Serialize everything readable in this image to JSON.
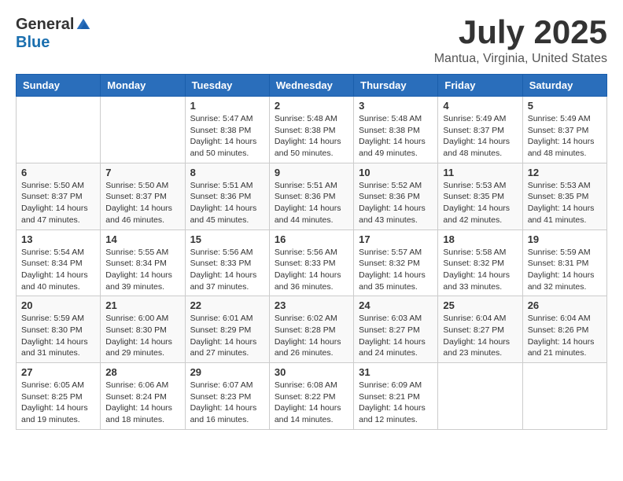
{
  "logo": {
    "general": "General",
    "blue": "Blue"
  },
  "title": "July 2025",
  "location": "Mantua, Virginia, United States",
  "weekdays": [
    "Sunday",
    "Monday",
    "Tuesday",
    "Wednesday",
    "Thursday",
    "Friday",
    "Saturday"
  ],
  "weeks": [
    [
      {
        "day": "",
        "sunrise": "",
        "sunset": "",
        "daylight": ""
      },
      {
        "day": "",
        "sunrise": "",
        "sunset": "",
        "daylight": ""
      },
      {
        "day": "1",
        "sunrise": "Sunrise: 5:47 AM",
        "sunset": "Sunset: 8:38 PM",
        "daylight": "Daylight: 14 hours and 50 minutes."
      },
      {
        "day": "2",
        "sunrise": "Sunrise: 5:48 AM",
        "sunset": "Sunset: 8:38 PM",
        "daylight": "Daylight: 14 hours and 50 minutes."
      },
      {
        "day": "3",
        "sunrise": "Sunrise: 5:48 AM",
        "sunset": "Sunset: 8:38 PM",
        "daylight": "Daylight: 14 hours and 49 minutes."
      },
      {
        "day": "4",
        "sunrise": "Sunrise: 5:49 AM",
        "sunset": "Sunset: 8:37 PM",
        "daylight": "Daylight: 14 hours and 48 minutes."
      },
      {
        "day": "5",
        "sunrise": "Sunrise: 5:49 AM",
        "sunset": "Sunset: 8:37 PM",
        "daylight": "Daylight: 14 hours and 48 minutes."
      }
    ],
    [
      {
        "day": "6",
        "sunrise": "Sunrise: 5:50 AM",
        "sunset": "Sunset: 8:37 PM",
        "daylight": "Daylight: 14 hours and 47 minutes."
      },
      {
        "day": "7",
        "sunrise": "Sunrise: 5:50 AM",
        "sunset": "Sunset: 8:37 PM",
        "daylight": "Daylight: 14 hours and 46 minutes."
      },
      {
        "day": "8",
        "sunrise": "Sunrise: 5:51 AM",
        "sunset": "Sunset: 8:36 PM",
        "daylight": "Daylight: 14 hours and 45 minutes."
      },
      {
        "day": "9",
        "sunrise": "Sunrise: 5:51 AM",
        "sunset": "Sunset: 8:36 PM",
        "daylight": "Daylight: 14 hours and 44 minutes."
      },
      {
        "day": "10",
        "sunrise": "Sunrise: 5:52 AM",
        "sunset": "Sunset: 8:36 PM",
        "daylight": "Daylight: 14 hours and 43 minutes."
      },
      {
        "day": "11",
        "sunrise": "Sunrise: 5:53 AM",
        "sunset": "Sunset: 8:35 PM",
        "daylight": "Daylight: 14 hours and 42 minutes."
      },
      {
        "day": "12",
        "sunrise": "Sunrise: 5:53 AM",
        "sunset": "Sunset: 8:35 PM",
        "daylight": "Daylight: 14 hours and 41 minutes."
      }
    ],
    [
      {
        "day": "13",
        "sunrise": "Sunrise: 5:54 AM",
        "sunset": "Sunset: 8:34 PM",
        "daylight": "Daylight: 14 hours and 40 minutes."
      },
      {
        "day": "14",
        "sunrise": "Sunrise: 5:55 AM",
        "sunset": "Sunset: 8:34 PM",
        "daylight": "Daylight: 14 hours and 39 minutes."
      },
      {
        "day": "15",
        "sunrise": "Sunrise: 5:56 AM",
        "sunset": "Sunset: 8:33 PM",
        "daylight": "Daylight: 14 hours and 37 minutes."
      },
      {
        "day": "16",
        "sunrise": "Sunrise: 5:56 AM",
        "sunset": "Sunset: 8:33 PM",
        "daylight": "Daylight: 14 hours and 36 minutes."
      },
      {
        "day": "17",
        "sunrise": "Sunrise: 5:57 AM",
        "sunset": "Sunset: 8:32 PM",
        "daylight": "Daylight: 14 hours and 35 minutes."
      },
      {
        "day": "18",
        "sunrise": "Sunrise: 5:58 AM",
        "sunset": "Sunset: 8:32 PM",
        "daylight": "Daylight: 14 hours and 33 minutes."
      },
      {
        "day": "19",
        "sunrise": "Sunrise: 5:59 AM",
        "sunset": "Sunset: 8:31 PM",
        "daylight": "Daylight: 14 hours and 32 minutes."
      }
    ],
    [
      {
        "day": "20",
        "sunrise": "Sunrise: 5:59 AM",
        "sunset": "Sunset: 8:30 PM",
        "daylight": "Daylight: 14 hours and 31 minutes."
      },
      {
        "day": "21",
        "sunrise": "Sunrise: 6:00 AM",
        "sunset": "Sunset: 8:30 PM",
        "daylight": "Daylight: 14 hours and 29 minutes."
      },
      {
        "day": "22",
        "sunrise": "Sunrise: 6:01 AM",
        "sunset": "Sunset: 8:29 PM",
        "daylight": "Daylight: 14 hours and 27 minutes."
      },
      {
        "day": "23",
        "sunrise": "Sunrise: 6:02 AM",
        "sunset": "Sunset: 8:28 PM",
        "daylight": "Daylight: 14 hours and 26 minutes."
      },
      {
        "day": "24",
        "sunrise": "Sunrise: 6:03 AM",
        "sunset": "Sunset: 8:27 PM",
        "daylight": "Daylight: 14 hours and 24 minutes."
      },
      {
        "day": "25",
        "sunrise": "Sunrise: 6:04 AM",
        "sunset": "Sunset: 8:27 PM",
        "daylight": "Daylight: 14 hours and 23 minutes."
      },
      {
        "day": "26",
        "sunrise": "Sunrise: 6:04 AM",
        "sunset": "Sunset: 8:26 PM",
        "daylight": "Daylight: 14 hours and 21 minutes."
      }
    ],
    [
      {
        "day": "27",
        "sunrise": "Sunrise: 6:05 AM",
        "sunset": "Sunset: 8:25 PM",
        "daylight": "Daylight: 14 hours and 19 minutes."
      },
      {
        "day": "28",
        "sunrise": "Sunrise: 6:06 AM",
        "sunset": "Sunset: 8:24 PM",
        "daylight": "Daylight: 14 hours and 18 minutes."
      },
      {
        "day": "29",
        "sunrise": "Sunrise: 6:07 AM",
        "sunset": "Sunset: 8:23 PM",
        "daylight": "Daylight: 14 hours and 16 minutes."
      },
      {
        "day": "30",
        "sunrise": "Sunrise: 6:08 AM",
        "sunset": "Sunset: 8:22 PM",
        "daylight": "Daylight: 14 hours and 14 minutes."
      },
      {
        "day": "31",
        "sunrise": "Sunrise: 6:09 AM",
        "sunset": "Sunset: 8:21 PM",
        "daylight": "Daylight: 14 hours and 12 minutes."
      },
      {
        "day": "",
        "sunrise": "",
        "sunset": "",
        "daylight": ""
      },
      {
        "day": "",
        "sunrise": "",
        "sunset": "",
        "daylight": ""
      }
    ]
  ]
}
